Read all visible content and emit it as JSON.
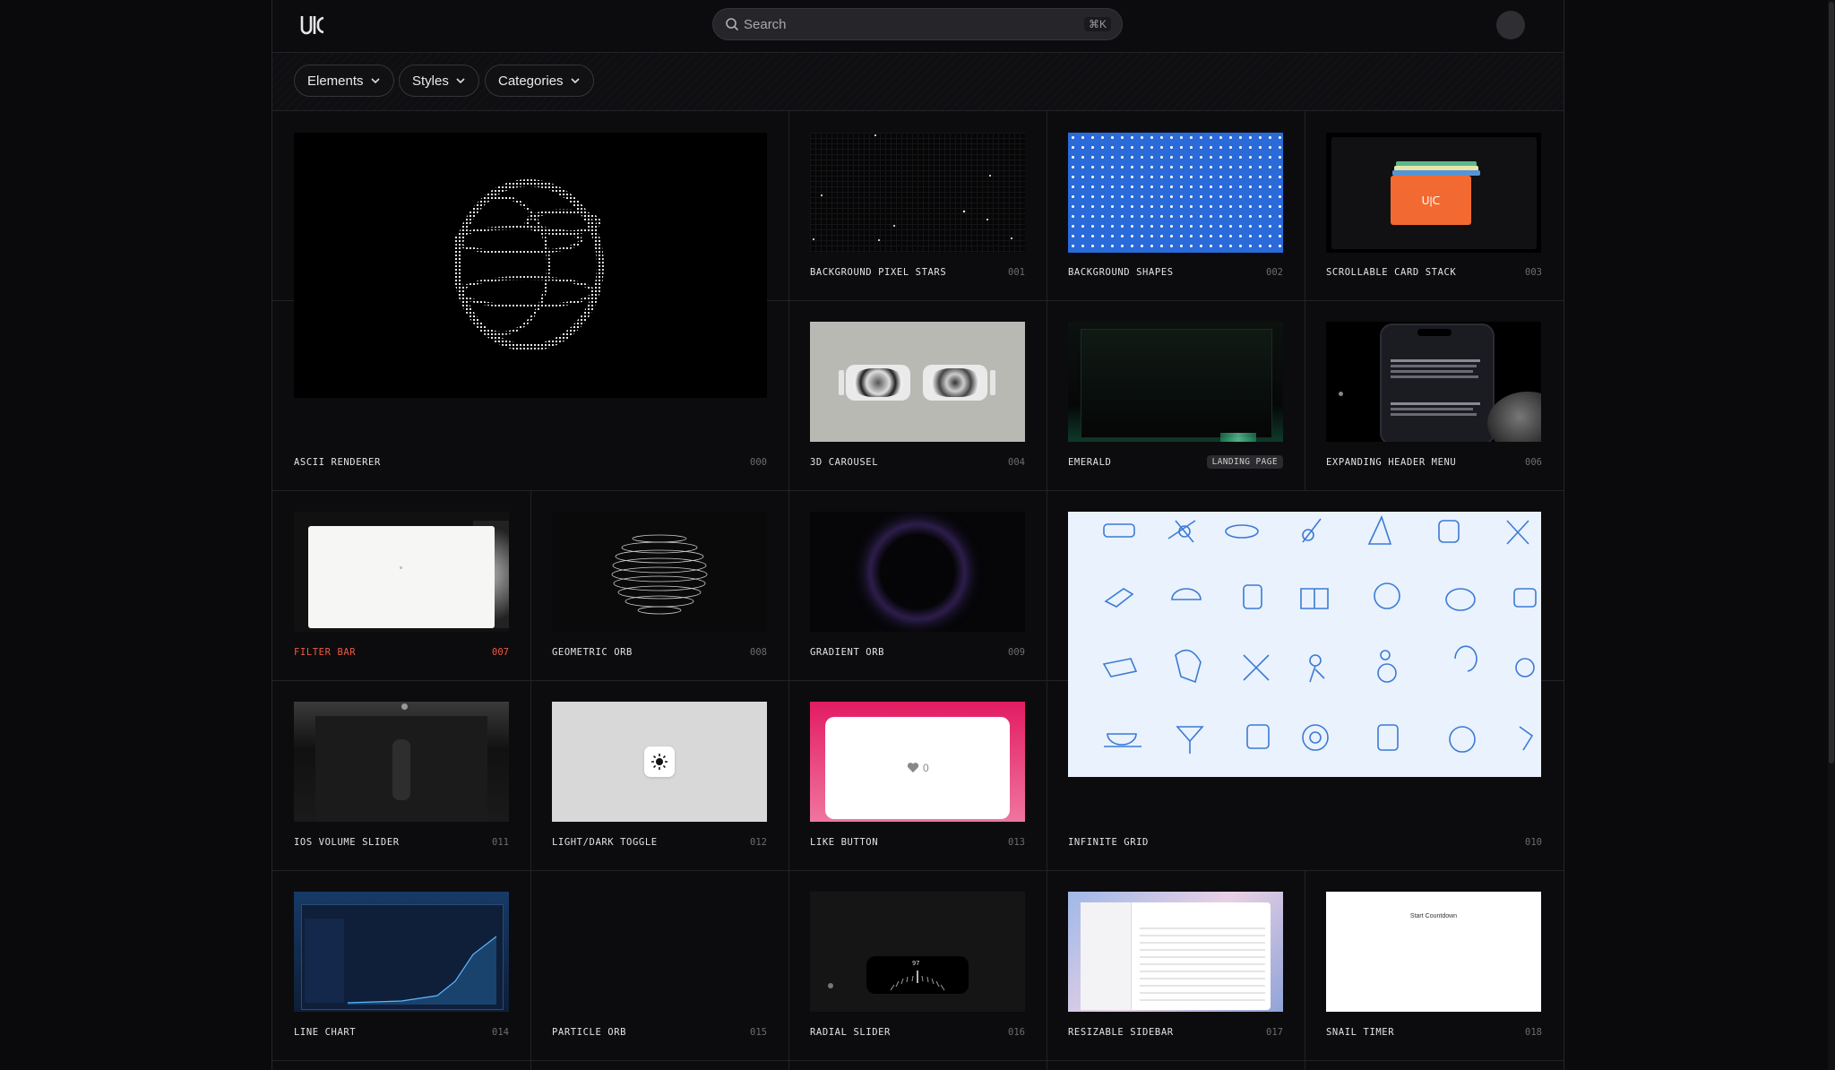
{
  "header": {
    "search_placeholder": "Search",
    "search_shortcut": "⌘K"
  },
  "filters": [
    {
      "label": "Elements"
    },
    {
      "label": "Styles"
    },
    {
      "label": "Categories"
    }
  ],
  "cards": [
    {
      "title": "ASCII RENDERER",
      "num": "000"
    },
    {
      "title": "BACKGROUND PIXEL STARS",
      "num": "001"
    },
    {
      "title": "BACKGROUND SHAPES",
      "num": "002"
    },
    {
      "title": "SCROLLABLE CARD STACK",
      "num": "003"
    },
    {
      "title": "3D CAROUSEL",
      "num": "004"
    },
    {
      "title": "EMERALD",
      "tag": "LANDING PAGE"
    },
    {
      "title": "EXPANDING HEADER MENU",
      "num": "006"
    },
    {
      "title": "FILTER BAR",
      "num": "007"
    },
    {
      "title": "GEOMETRIC ORB",
      "num": "008"
    },
    {
      "title": "GRADIENT ORB",
      "num": "009"
    },
    {
      "title": "INFINITE GRID",
      "num": "010"
    },
    {
      "title": "IOS VOLUME SLIDER",
      "num": "011"
    },
    {
      "title": "LIGHT/DARK TOGGLE",
      "num": "012"
    },
    {
      "title": "LIKE BUTTON",
      "num": "013"
    },
    {
      "title": "LINE CHART",
      "num": "014"
    },
    {
      "title": "PARTICLE ORB",
      "num": "015"
    },
    {
      "title": "RADIAL SLIDER",
      "num": "016"
    },
    {
      "title": "RESIZABLE SIDEBAR",
      "num": "017"
    },
    {
      "title": "SNAIL TIMER",
      "num": "018"
    }
  ],
  "thumb_text": {
    "like_count": "0",
    "radial_value": "97",
    "snail_title": "Start Countdown"
  },
  "colors": {
    "accent_red": "#ef5a43",
    "shapes_blue": "#2a6ad9",
    "like_pink": "#e21c62",
    "card_orange": "#f26a32",
    "grid_blue": "#eaf2fd"
  }
}
